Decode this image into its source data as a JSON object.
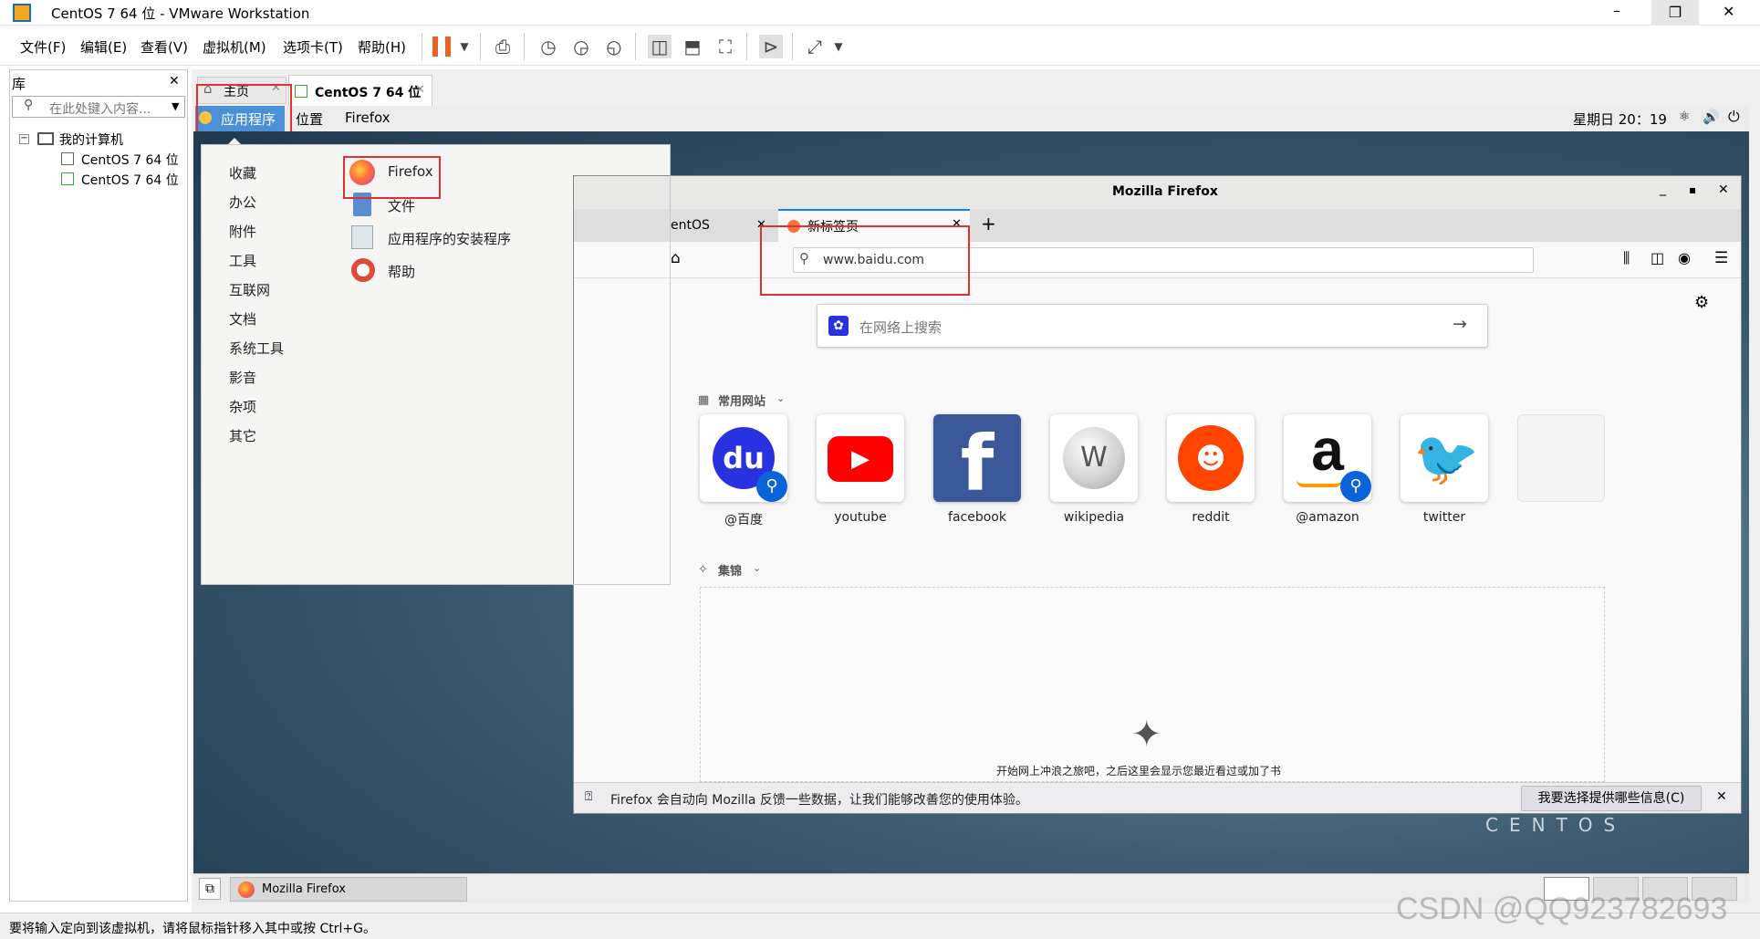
{
  "window": {
    "title": "CentOS 7 64 位 - VMware Workstation",
    "min": "–",
    "max": "❐",
    "close": "✕"
  },
  "menubar": [
    "文件(F)",
    "编辑(E)",
    "查看(V)",
    "虚拟机(M)",
    "选项卡(T)",
    "帮助(H)"
  ],
  "library": {
    "title": "库",
    "close": "✕",
    "search_placeholder": "在此处键入内容...",
    "tree_root": "我的计算机",
    "tree_items": [
      "CentOS 7 64 位",
      "CentOS 7 64 位"
    ]
  },
  "vmtabs": {
    "home": "主页",
    "vm": "CentOS 7 64 位"
  },
  "gnome": {
    "apps": "应用程序",
    "places": "位置",
    "app": "Firefox",
    "clock": "星期日 20：19"
  },
  "apps_menu": {
    "categories": [
      "收藏",
      "办公",
      "附件",
      "工具",
      "互联网",
      "文档",
      "系统工具",
      "影音",
      "杂项",
      "其它"
    ],
    "apps": [
      "Firefox",
      "文件",
      "应用程序的安装程序",
      "帮助"
    ]
  },
  "firefox": {
    "title": "Mozilla Firefox",
    "tab1": "entOS",
    "tab2": "新标签页",
    "url": "www.baidu.com",
    "search_placeholder": "在网络上搜索",
    "topsites_label": "常用网站",
    "highlights_label": "集锦",
    "empty_msg": "开始网上冲浪之旅吧，之后这里会显示您最近看过或加了书",
    "sites": [
      "@百度",
      "youtube",
      "facebook",
      "wikipedia",
      "reddit",
      "@amazon",
      "twitter"
    ],
    "notice": "Firefox 会自动向 Mozilla 反馈一些数据，让我们能够改善您的使用体验。",
    "notice_btn": "我要选择提供哪些信息(C)"
  },
  "taskbar": {
    "item": "Mozilla Firefox"
  },
  "centos_brand": "CENTOS",
  "status": "要将输入定向到该虚拟机，请将鼠标指针移入其中或按 Ctrl+G。",
  "watermark": "CSDN @QQ923782693"
}
